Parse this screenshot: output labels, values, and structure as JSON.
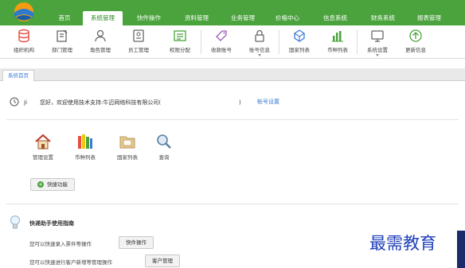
{
  "nav": {
    "items": [
      {
        "label": "首页"
      },
      {
        "label": "系统管理"
      },
      {
        "label": "快件操作"
      },
      {
        "label": "资料管理"
      },
      {
        "label": "业务管理"
      },
      {
        "label": "价格中心"
      },
      {
        "label": "信息系统"
      },
      {
        "label": "财务系统"
      },
      {
        "label": "报表管理"
      }
    ],
    "active": "系统管理"
  },
  "toolbar": {
    "items": [
      {
        "label": "组织机构",
        "icon": "database-icon"
      },
      {
        "label": "部门管理",
        "icon": "edit-doc-icon"
      },
      {
        "label": "角色管理",
        "icon": "user-icon"
      },
      {
        "label": "员工管理",
        "icon": "id-card-icon"
      },
      {
        "label": "权限分配",
        "icon": "permission-icon"
      },
      {
        "label": "收款账号",
        "icon": "tag-icon"
      },
      {
        "label": "账号信息",
        "icon": "lock-icon"
      },
      {
        "label": "国家列表",
        "icon": "globe-icon"
      },
      {
        "label": "币种列表",
        "icon": "bar-chart-icon"
      },
      {
        "label": "系统设置",
        "icon": "monitor-icon"
      },
      {
        "label": "更新信息",
        "icon": "arrow-up-circle-icon"
      }
    ]
  },
  "tabs": [
    {
      "label": "系统首页"
    }
  ],
  "welcome": {
    "user_initial": "ji",
    "text": "您好，欢迎使用技术支持:牛迈网络科技有限公司(",
    "paren_close": ")",
    "account_link": "帐号设置"
  },
  "shortcuts": {
    "items": [
      {
        "label": "管理设置",
        "icon": "home-icon"
      },
      {
        "label": "币种列表",
        "icon": "books-icon"
      },
      {
        "label": "国家列表",
        "icon": "folder-icon"
      },
      {
        "label": "查询",
        "icon": "magnifier-icon"
      }
    ],
    "quick_button": "快捷功能"
  },
  "guide": {
    "title": "快递助手使用指南",
    "line1": "您可以快速录入票件等操作",
    "line1_button": "快件操作",
    "line2": "您可以快速进行客户新增等管理操作",
    "line2_button": "客户管理"
  },
  "watermark": "最需教育",
  "colors": {
    "nav_green": "#4aa33c",
    "link_blue": "#3a7bd5",
    "watermark_blue": "#1f3fb8"
  }
}
